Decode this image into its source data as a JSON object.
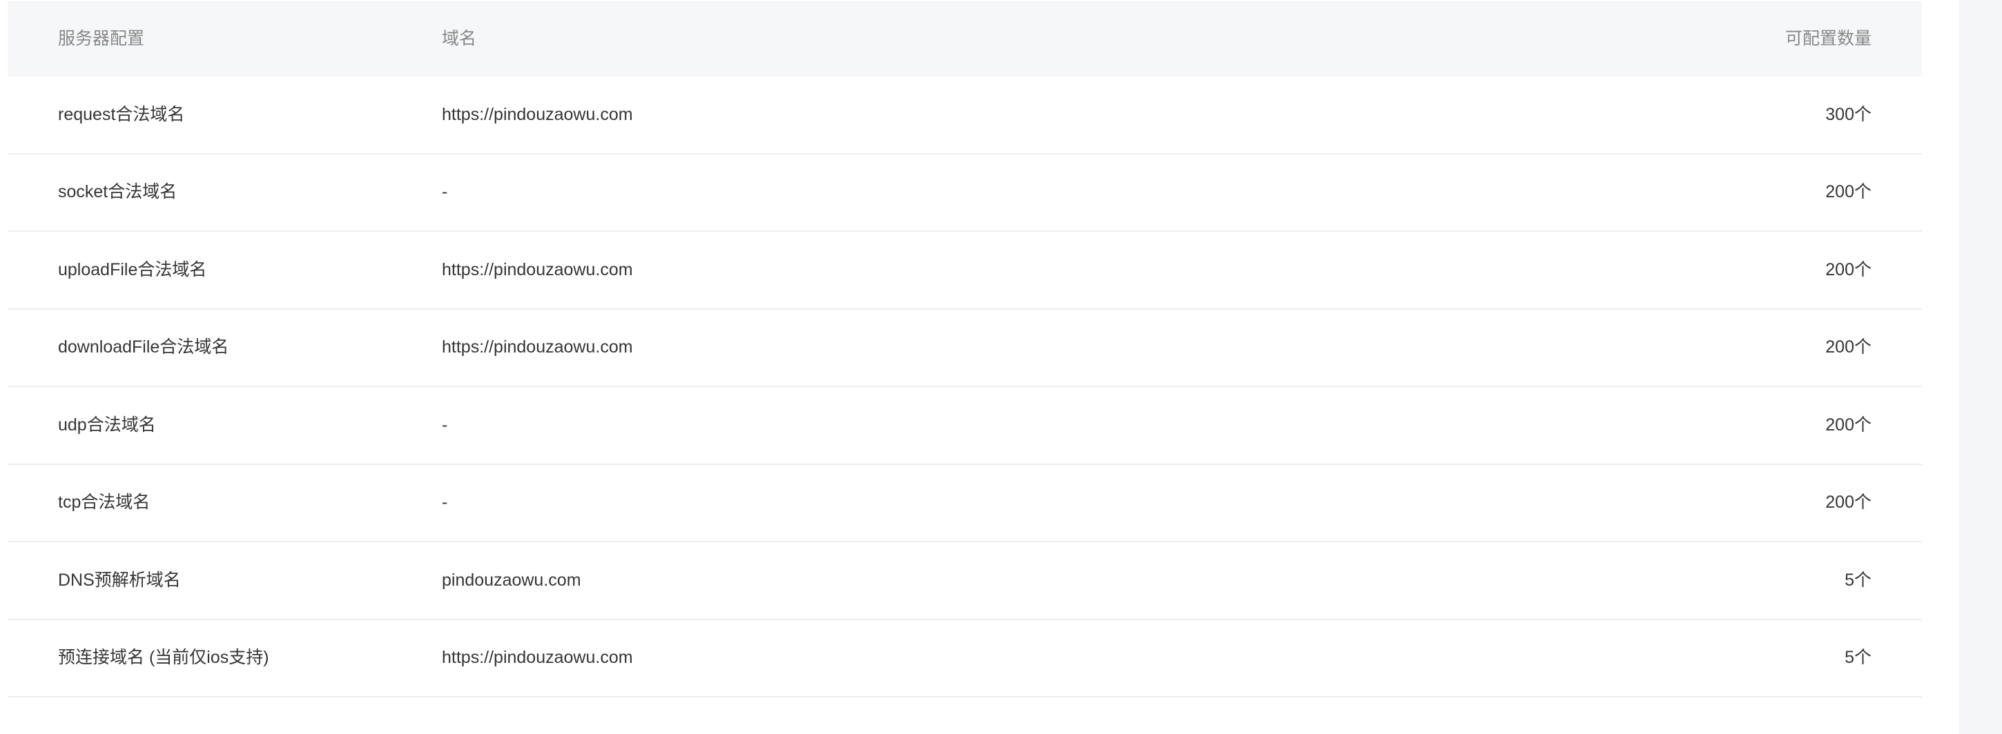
{
  "table": {
    "headers": {
      "config": "服务器配置",
      "domain": "域名",
      "count": "可配置数量"
    },
    "rows": [
      {
        "config": "request合法域名",
        "domain": "https://pindouzaowu.com",
        "count": "300个"
      },
      {
        "config": "socket合法域名",
        "domain": "-",
        "count": "200个"
      },
      {
        "config": "uploadFile合法域名",
        "domain": "https://pindouzaowu.com",
        "count": "200个"
      },
      {
        "config": "downloadFile合法域名",
        "domain": "https://pindouzaowu.com",
        "count": "200个"
      },
      {
        "config": "udp合法域名",
        "domain": "-",
        "count": "200个"
      },
      {
        "config": "tcp合法域名",
        "domain": "-",
        "count": "200个"
      },
      {
        "config": "DNS预解析域名",
        "domain": "pindouzaowu.com",
        "count": "5个"
      },
      {
        "config": "预连接域名 (当前仅ios支持)",
        "domain": "https://pindouzaowu.com",
        "count": "5个"
      }
    ]
  },
  "colors": {
    "header_bg": "#f6f7f9",
    "header_text": "#878787",
    "body_text": "#353535",
    "row_divider": "#eceef1",
    "scrollbar_track": "#f5f6f8"
  }
}
